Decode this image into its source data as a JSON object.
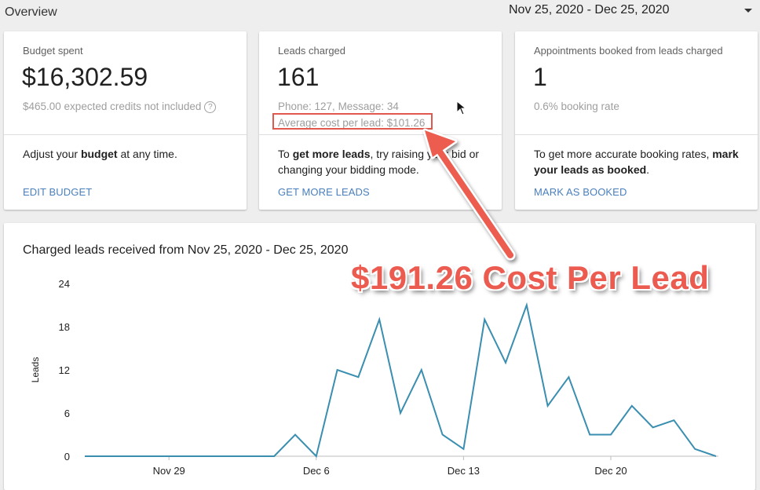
{
  "header": {
    "title": "Overview",
    "date_range": "Nov 25, 2020 - Dec 25, 2020"
  },
  "cards": {
    "budget": {
      "label": "Budget spent",
      "value": "$16,302.59",
      "sub": "$465.00 expected credits not included",
      "help_icon": "?",
      "body_pre": "Adjust your ",
      "body_bold": "budget",
      "body_post": " at any time.",
      "link": "EDIT BUDGET"
    },
    "leads": {
      "label": "Leads charged",
      "value": "161",
      "sub": "Phone: 127, Message: 34",
      "sub2": "Average cost per lead: $101.26",
      "body_pre": "To ",
      "body_bold": "get more leads",
      "body_post": ", try raising your bid or changing your bidding mode.",
      "link": "GET MORE LEADS"
    },
    "appointments": {
      "label": "Appointments booked from leads charged",
      "value": "1",
      "sub": "0.6% booking rate",
      "body_pre": "To get more accurate booking rates, ",
      "body_bold": "mark your leads as booked",
      "body_post": ".",
      "link": "MARK AS BOOKED"
    }
  },
  "annotation": {
    "text": "$191.26 Cost Per Lead",
    "color": "#ec5b50"
  },
  "chart_title": "Charged leads received from Nov 25, 2020 - Dec 25, 2020",
  "chart_data": {
    "type": "line",
    "title": "Charged leads received from Nov 25, 2020 - Dec 25, 2020",
    "ylabel": "Leads",
    "xlabel": "",
    "ylim": [
      0,
      24
    ],
    "yticks": [
      0,
      6,
      12,
      18,
      24
    ],
    "x_tick_labels": [
      "Nov 29",
      "Dec 6",
      "Dec 13",
      "Dec 20"
    ],
    "x_tick_indices": [
      4,
      11,
      18,
      25
    ],
    "grid": false,
    "line_color": "#3a8eb0",
    "series": [
      {
        "values": [
          0,
          0,
          0,
          0,
          0,
          0,
          0,
          0,
          0,
          0,
          3,
          0,
          12,
          11,
          19,
          6,
          12,
          3,
          1,
          19,
          13,
          21,
          7,
          11,
          3,
          3,
          7,
          4,
          5,
          1,
          0
        ]
      }
    ]
  }
}
